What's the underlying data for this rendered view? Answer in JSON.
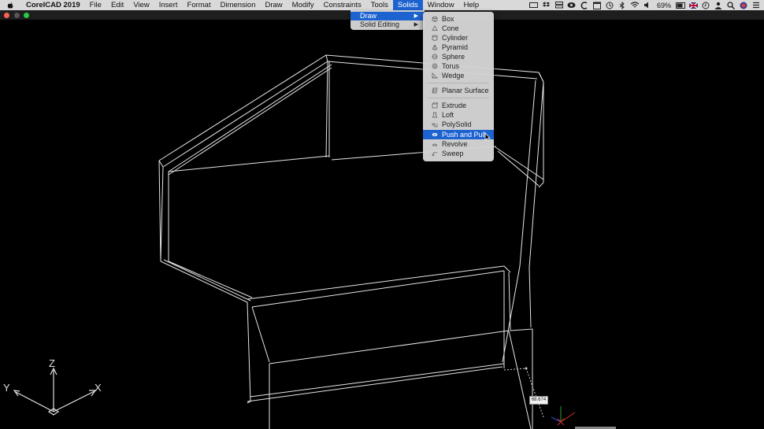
{
  "menubar": {
    "app_name": "CorelCAD 2019",
    "items": [
      "File",
      "Edit",
      "View",
      "Insert",
      "Format",
      "Dimension",
      "Draw",
      "Modify",
      "Constraints",
      "Tools",
      "Solids",
      "Window",
      "Help"
    ],
    "active_item": "Solids",
    "battery_percent": "69%"
  },
  "solids_menu": {
    "items": [
      {
        "label": "Draw",
        "has_submenu": true,
        "active": true
      },
      {
        "label": "Solid Editing",
        "has_submenu": true,
        "active": false
      }
    ]
  },
  "draw_menu": {
    "items": [
      {
        "label": "Box",
        "icon": "box-icon"
      },
      {
        "label": "Cone",
        "icon": "cone-icon"
      },
      {
        "label": "Cylinder",
        "icon": "cylinder-icon"
      },
      {
        "label": "Pyramid",
        "icon": "pyramid-icon"
      },
      {
        "label": "Sphere",
        "icon": "sphere-icon"
      },
      {
        "label": "Torus",
        "icon": "torus-icon"
      },
      {
        "label": "Wedge",
        "icon": "wedge-icon"
      },
      {
        "label": "Planar Surface",
        "icon": "planar-surface-icon"
      },
      {
        "label": "Extrude",
        "icon": "extrude-icon"
      },
      {
        "label": "Loft",
        "icon": "loft-icon"
      },
      {
        "label": "PolySolid",
        "icon": "polysolid-icon"
      },
      {
        "label": "Push and Pull",
        "icon": "push-pull-icon"
      },
      {
        "label": "Revolve",
        "icon": "revolve-icon"
      },
      {
        "label": "Sweep",
        "icon": "sweep-icon"
      }
    ],
    "highlighted": "Push and Pull"
  },
  "ucs": {
    "x_label": "X",
    "y_label": "Y",
    "z_label": "Z"
  },
  "dimension_value": "68.674",
  "colors": {
    "menu_highlight": "#1d63d0",
    "viewport_bg": "#000000",
    "wireframe": "#e6e6e6"
  }
}
